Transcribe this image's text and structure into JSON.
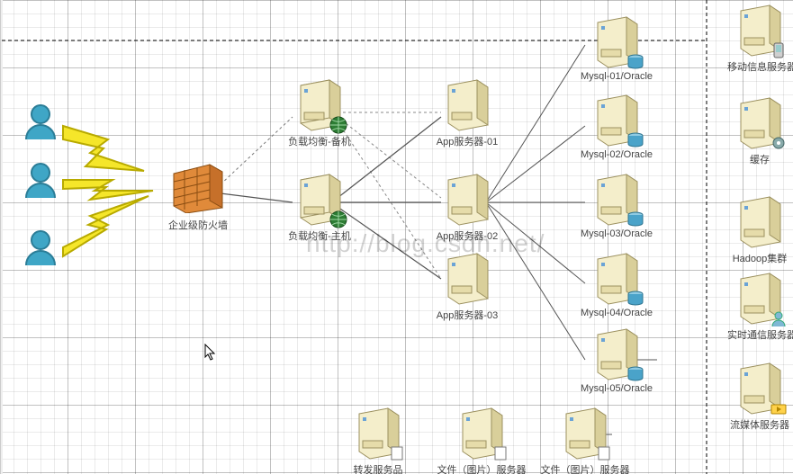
{
  "watermark": "http://blog.csdn.net/",
  "users": {
    "u1": "",
    "u2": "",
    "u3": ""
  },
  "firewall": {
    "label": "企业级防火墙"
  },
  "lb_backup": {
    "label": "负载均衡-备机"
  },
  "lb_main": {
    "label": "负载均衡-主机"
  },
  "app": {
    "a1": "App服务器-01",
    "a2": "App服务器-02",
    "a3": "App服务器-03"
  },
  "db": {
    "d1": "Mysql-01/Oracle",
    "d2": "Mysql-02/Oracle",
    "d3": "Mysql-03/Oracle",
    "d4": "Mysql-04/Oracle",
    "d5": "Mysql-05/Oracle"
  },
  "sidebar": {
    "mobile": "移动信息服务器",
    "cache": "缓存",
    "hadoop": "Hadoop集群",
    "im": "实时通信服务器",
    "stream": "流媒体服务器"
  },
  "bottom": {
    "forward": "转发服务品",
    "file1": "文件（图片）服务器",
    "file2": "文件（图片）服务器"
  },
  "colors": {
    "user": "#3fa6c6",
    "firewall_brick": "#e08a3a",
    "firewall_dark": "#c6702a",
    "server_face": "#f4eecb",
    "server_side": "#d9cf9a",
    "server_shadow": "#b8ad79",
    "globe": "#2d7d34",
    "db_cyl": "#4aa3c9",
    "lightning": "#f5e62a",
    "lightning_stroke": "#b8aa00"
  }
}
